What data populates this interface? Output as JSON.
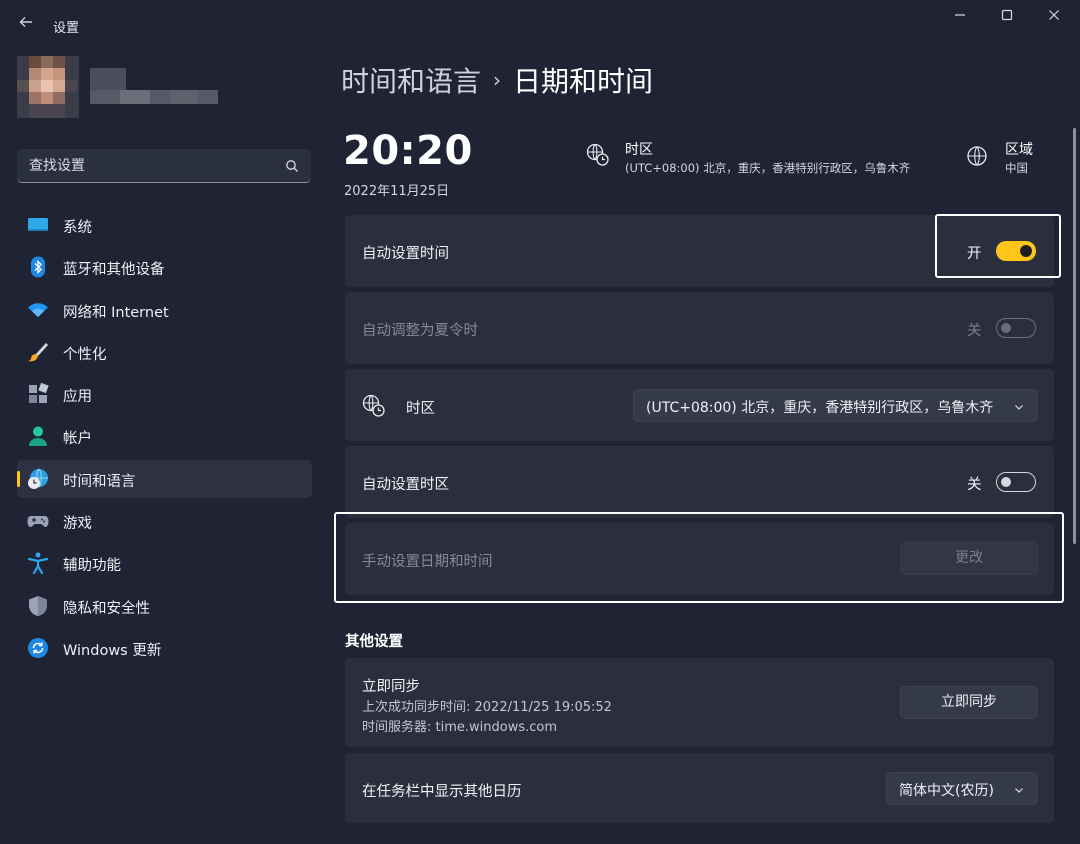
{
  "window": {
    "title": "设置",
    "back_icon": "arrow-left-icon",
    "controls": [
      "minimize",
      "maximize",
      "close"
    ]
  },
  "search": {
    "placeholder": "查找设置",
    "icon": "search-icon"
  },
  "sidebar": {
    "items": [
      {
        "label": "系统",
        "icon": "monitor-icon",
        "active": false
      },
      {
        "label": "蓝牙和其他设备",
        "icon": "bluetooth-icon",
        "active": false
      },
      {
        "label": "网络和 Internet",
        "icon": "wifi-icon",
        "active": false
      },
      {
        "label": "个性化",
        "icon": "brush-icon",
        "active": false
      },
      {
        "label": "应用",
        "icon": "apps-icon",
        "active": false
      },
      {
        "label": "帐户",
        "icon": "person-icon",
        "active": false
      },
      {
        "label": "时间和语言",
        "icon": "globe-clock-icon",
        "active": true
      },
      {
        "label": "游戏",
        "icon": "gamepad-icon",
        "active": false
      },
      {
        "label": "辅助功能",
        "icon": "accessibility-icon",
        "active": false
      },
      {
        "label": "隐私和安全性",
        "icon": "shield-icon",
        "active": false
      },
      {
        "label": "Windows 更新",
        "icon": "refresh-icon",
        "active": false
      }
    ]
  },
  "breadcrumb": {
    "parent": "时间和语言",
    "separator": "›",
    "current": "日期和时间"
  },
  "summary": {
    "time": "20:20",
    "date": "2022年11月25日",
    "timezone_title": "时区",
    "timezone_value": "(UTC+08:00) 北京，重庆，香港特别行政区，乌鲁木齐",
    "region_title": "区域",
    "region_value": "中国"
  },
  "settings": {
    "auto_time": {
      "label": "自动设置时间",
      "state_text": "开",
      "on": true
    },
    "auto_dst": {
      "label": "自动调整为夏令时",
      "state_text": "关",
      "on": false,
      "disabled": true
    },
    "timezone": {
      "label": "时区",
      "selected": "(UTC+08:00) 北京，重庆，香港特别行政区，乌鲁木齐"
    },
    "auto_timezone": {
      "label": "自动设置时区",
      "state_text": "关",
      "on": false
    },
    "manual": {
      "label": "手动设置日期和时间",
      "button": "更改",
      "disabled": true
    }
  },
  "other": {
    "section_title": "其他设置",
    "sync": {
      "title": "立即同步",
      "last_sync": "上次成功同步时间: 2022/11/25 19:05:52",
      "server": "时间服务器: time.windows.com",
      "button": "立即同步"
    },
    "calendar": {
      "label": "在任务栏中显示其他日历",
      "selected": "简体中文(农历)"
    }
  },
  "colors": {
    "accent": "#ffc518",
    "background": "#1f2333",
    "card": "#2a2e3d"
  }
}
